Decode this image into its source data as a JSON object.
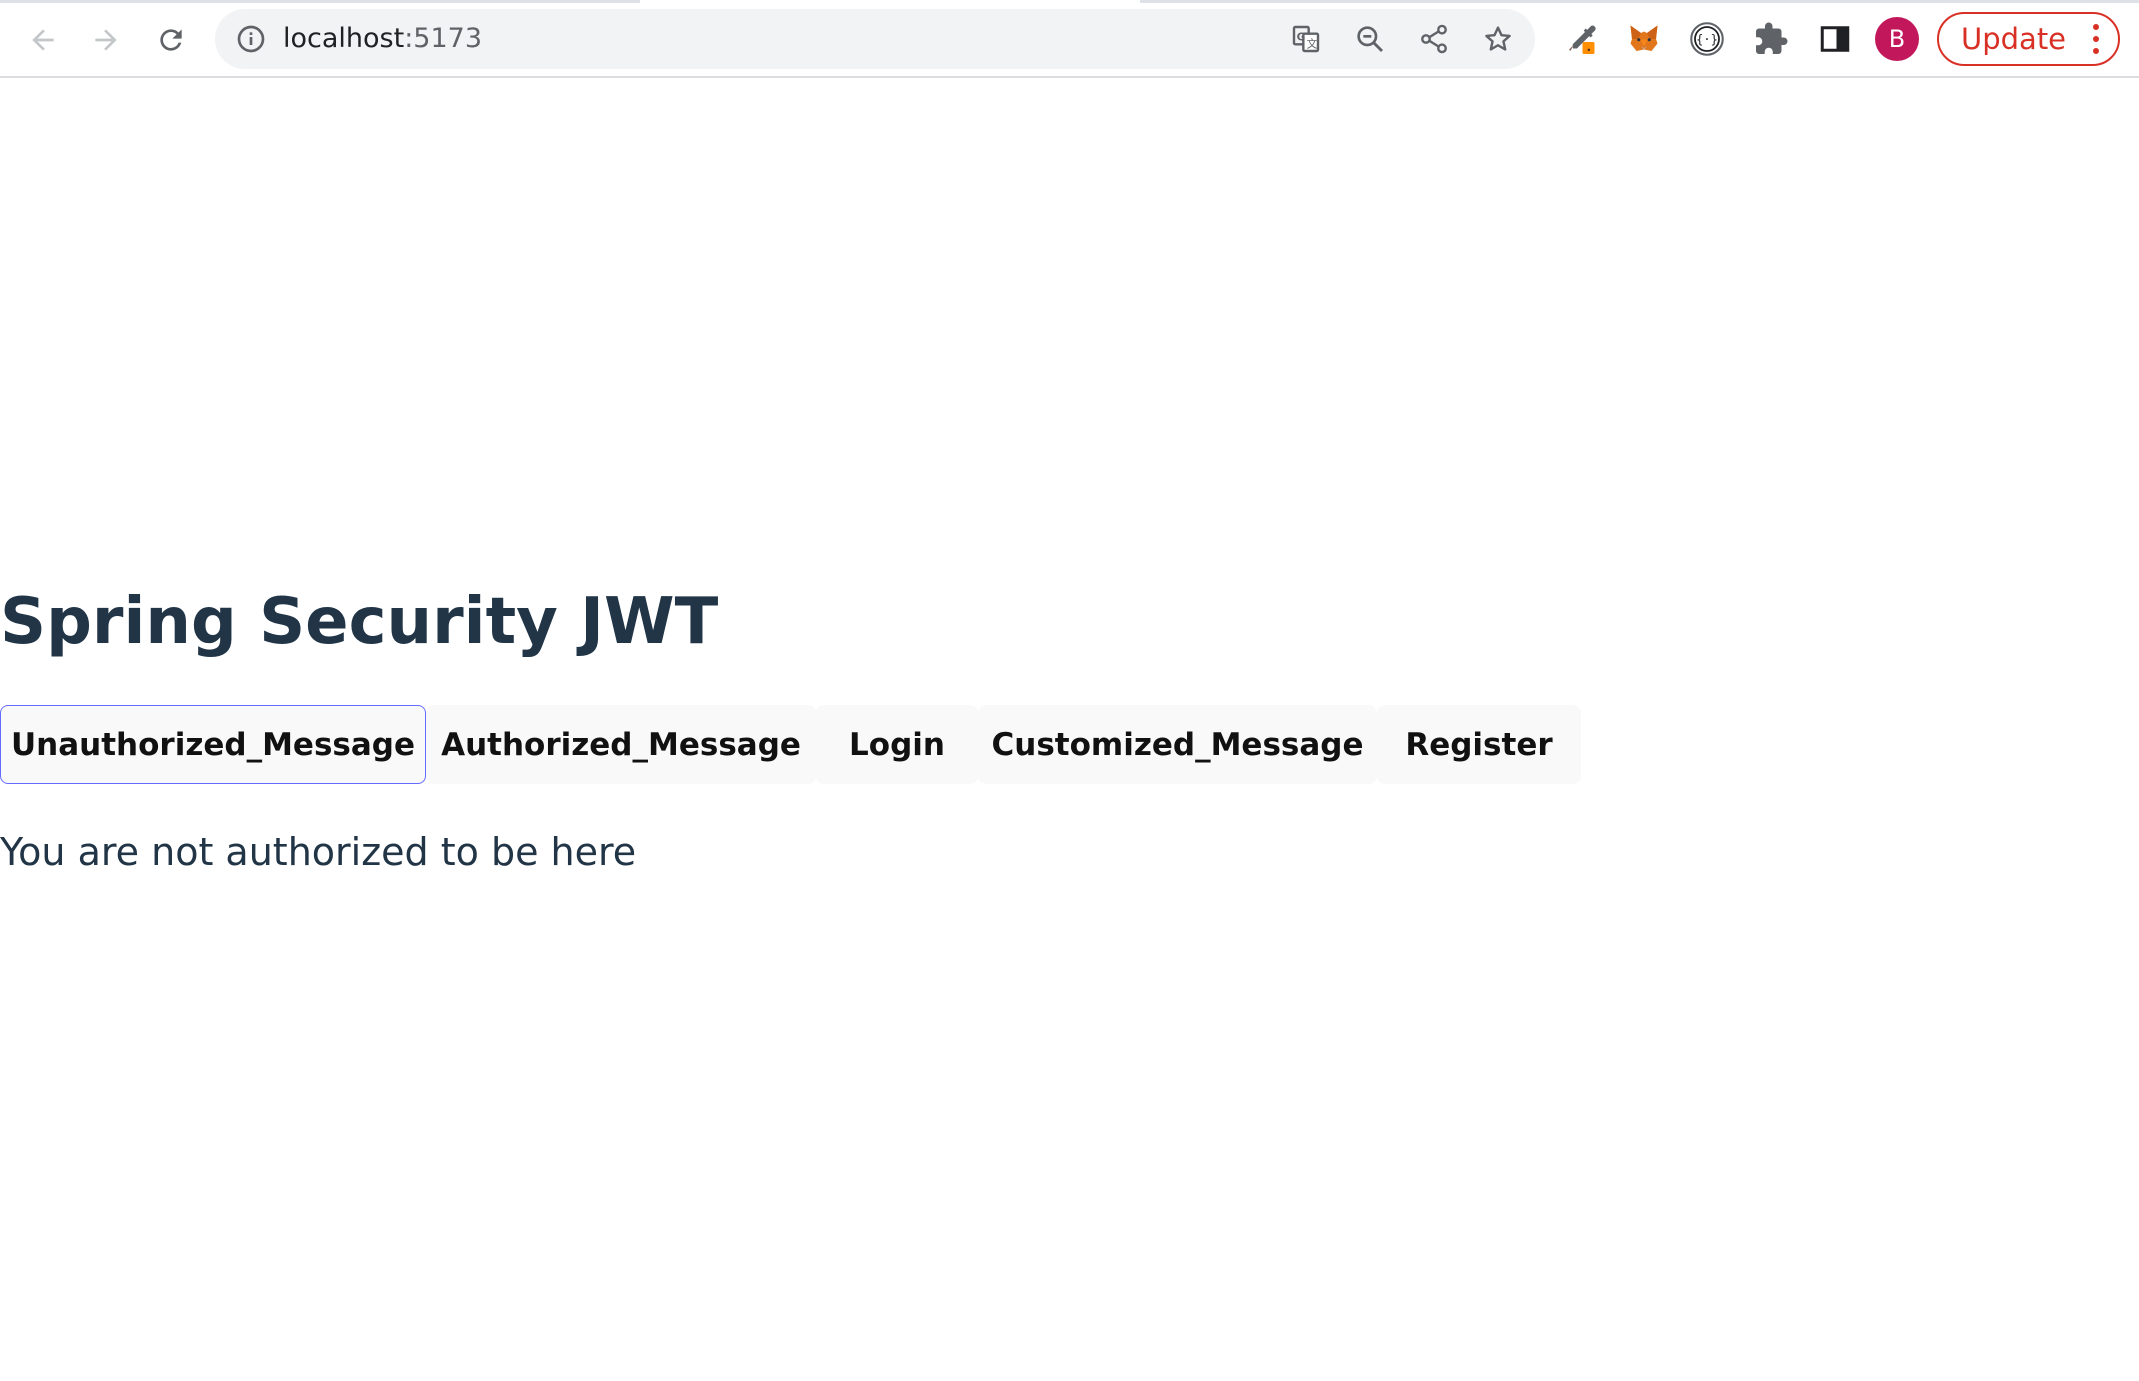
{
  "browser": {
    "url_host": "localhost",
    "url_port": ":5173",
    "avatar_initial": "B",
    "update_label": "Update",
    "icons": {
      "back": "arrow-back-icon",
      "forward": "arrow-forward-icon",
      "reload": "reload-icon",
      "site_info": "info-icon",
      "translate": "translate-icon",
      "zoom": "zoom-out-icon",
      "share": "share-icon",
      "bookmark": "star-icon",
      "eyedropper_ext": "eyedropper-icon",
      "metamask_ext": "fox-icon",
      "json_ext": "braces-icon",
      "extensions": "puzzle-icon",
      "side_panel": "side-panel-icon",
      "menu": "kebab-menu-icon"
    },
    "colors": {
      "update_red": "#d93025",
      "avatar_bg": "#c2185b"
    }
  },
  "page": {
    "title": "Spring Security JWT",
    "tabs": [
      {
        "label": "Unauthorized_Message",
        "active": true
      },
      {
        "label": "Authorized_Message",
        "active": false
      },
      {
        "label": "Login",
        "active": false
      },
      {
        "label": "Customized_Message",
        "active": false
      },
      {
        "label": "Register",
        "active": false
      }
    ],
    "message": "You are not authorized to be here",
    "colors": {
      "text": "#213547",
      "active_border": "#646cff",
      "button_bg": "#f9f9f9"
    }
  }
}
